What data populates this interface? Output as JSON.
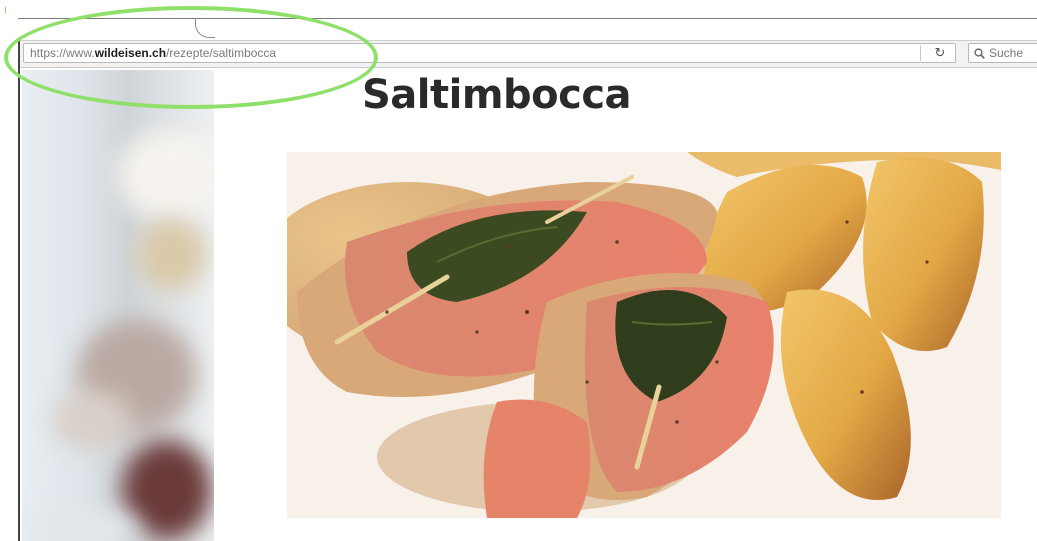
{
  "browser": {
    "url": {
      "prefix": "https://www.",
      "host": "wildeisen.ch",
      "path": "/rezepte/saltimbocca"
    },
    "reload_icon": "reload-icon",
    "search": {
      "icon": "search-icon",
      "placeholder": "Suche"
    }
  },
  "page": {
    "title": "Saltimbocca",
    "hero_image": "saltimbocca-dish-photo"
  },
  "annotation": {
    "highlight_color": "#8ee06a"
  }
}
